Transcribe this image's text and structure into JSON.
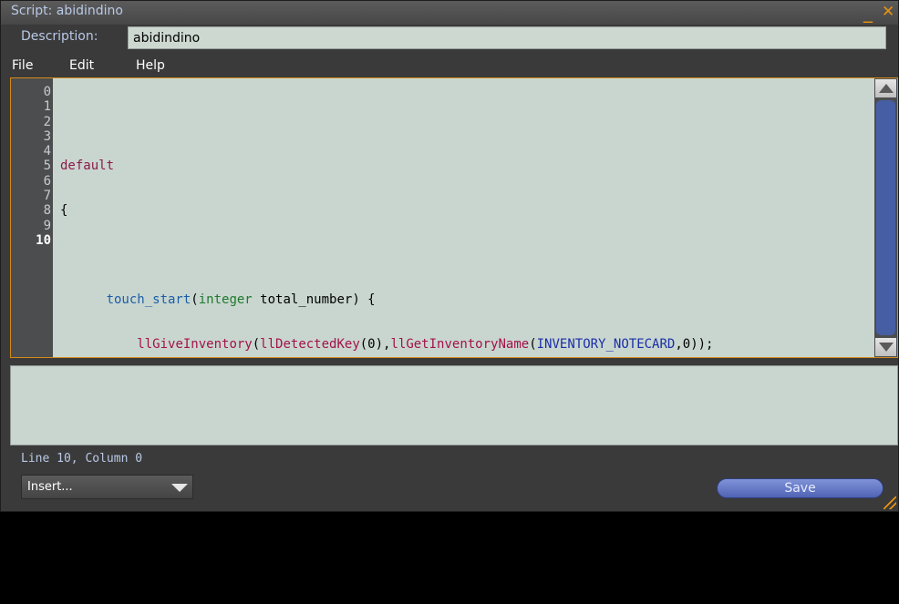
{
  "window": {
    "title": "Script: abidindino",
    "minimize_glyph": "_",
    "close_glyph": "✕",
    "accent": "#e8930f"
  },
  "description": {
    "label": "Description:",
    "value": "abidindino"
  },
  "menu": {
    "items": [
      "File",
      "Edit",
      "Help"
    ]
  },
  "editor": {
    "line_numbers": [
      "0",
      "1",
      "2",
      "3",
      "4",
      "5",
      "6",
      "7",
      "8",
      "9",
      "10"
    ],
    "current_line": "10",
    "colors": {
      "keyword": "#8b1a4a",
      "event": "#1b5ea8",
      "type": "#1e7a2e",
      "function": "#a3124a",
      "constant": "#1a2ea8",
      "text": "#000000",
      "background": "#c9d6cf"
    },
    "code": {
      "l1_kw": "default",
      "l2": "{",
      "l4_event": "touch_start",
      "l4_open": "(",
      "l4_type": "integer",
      "l4_rest": " total_number) {",
      "l5_fn1": "llGiveInventory",
      "l5_open1": "(",
      "l5_fn2": "llDetectedKey",
      "l5_args2": "(0),",
      "l5_fn3": "llGetInventoryName",
      "l5_open3": "(",
      "l5_const": "INVENTORY_NOTECARD",
      "l5_tail": ",0));",
      "l7": "}",
      "l9": "}"
    }
  },
  "status": {
    "text": "Line 10, Column 0"
  },
  "insert_dropdown": {
    "selected": "Insert..."
  },
  "save_button": {
    "label": "Save"
  }
}
